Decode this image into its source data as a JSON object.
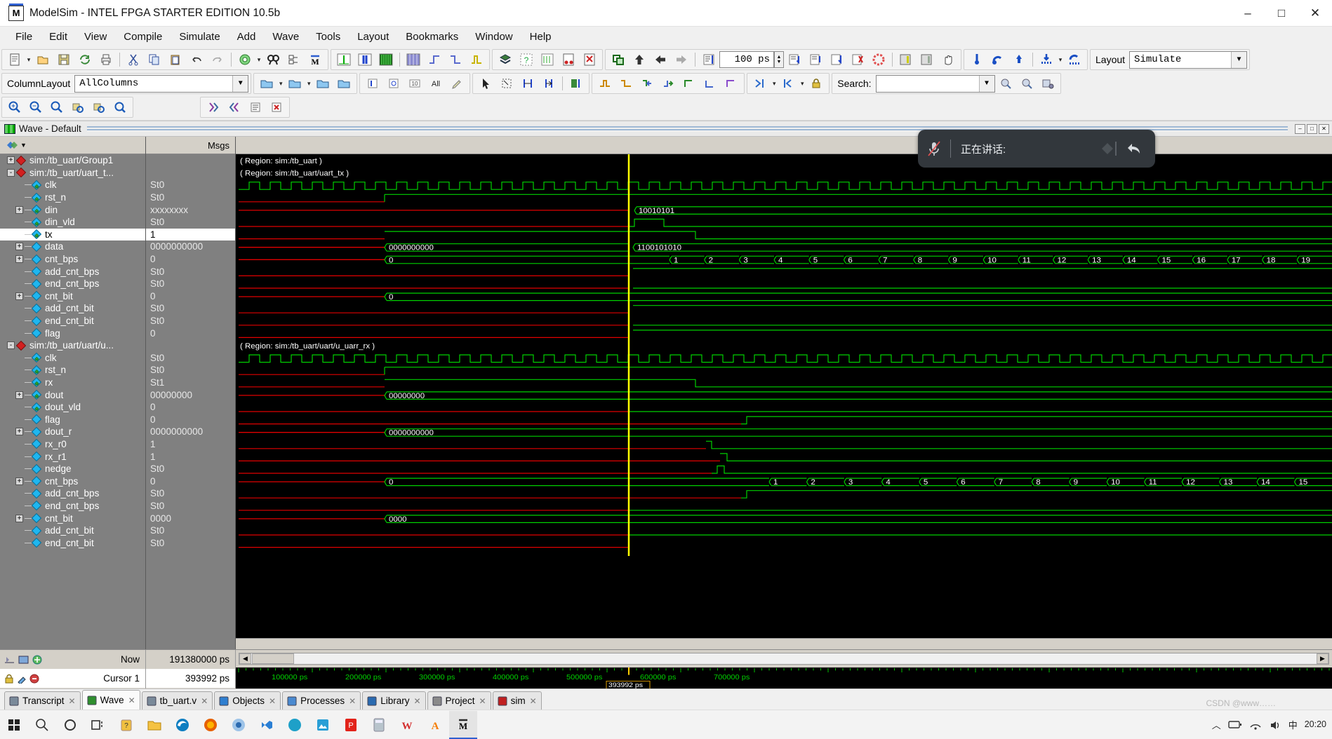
{
  "window": {
    "title": "ModelSim - INTEL FPGA STARTER EDITION 10.5b",
    "app_icon": "modelsim-icon",
    "minimize": "–",
    "maximize": "□",
    "close": "✕"
  },
  "menu": [
    "File",
    "Edit",
    "View",
    "Compile",
    "Simulate",
    "Add",
    "Wave",
    "Tools",
    "Layout",
    "Bookmarks",
    "Window",
    "Help"
  ],
  "toolbar": {
    "time_step_value": "100 ps",
    "column_layout_label": "ColumnLayout",
    "column_layout_value": "AllColumns",
    "layout_label": "Layout",
    "layout_value": "Simulate",
    "search_label": "Search:",
    "search_value": "",
    "search_placeholder": ""
  },
  "wave_window": {
    "caption": "Wave - Default",
    "col_names_header": "",
    "col_msgs_header": "Msgs",
    "minimize": "–",
    "maximize": "□",
    "close": "✕"
  },
  "signals": [
    {
      "name": "sim:/tb_uart/Group1",
      "value": "",
      "depth": 0,
      "expander": "+",
      "icon": "region-icon"
    },
    {
      "name": "sim:/tb_uart/uart_t...",
      "value": "",
      "depth": 0,
      "expander": "-",
      "icon": "region-icon"
    },
    {
      "name": "clk",
      "value": "St0",
      "depth": 1,
      "expander": "",
      "icon": "input-signal-icon"
    },
    {
      "name": "rst_n",
      "value": "St0",
      "depth": 1,
      "expander": "",
      "icon": "input-signal-icon"
    },
    {
      "name": "din",
      "value": "xxxxxxxx",
      "depth": 1,
      "expander": "+",
      "icon": "input-signal-icon"
    },
    {
      "name": "din_vld",
      "value": "St0",
      "depth": 1,
      "expander": "",
      "icon": "input-signal-icon"
    },
    {
      "name": "tx",
      "value": "1",
      "depth": 1,
      "expander": "",
      "icon": "output-signal-icon",
      "selected": true
    },
    {
      "name": "data",
      "value": "0000000000",
      "depth": 1,
      "expander": "+",
      "icon": "internal-signal-icon"
    },
    {
      "name": "cnt_bps",
      "value": "0",
      "depth": 1,
      "expander": "+",
      "icon": "internal-signal-icon"
    },
    {
      "name": "add_cnt_bps",
      "value": "St0",
      "depth": 1,
      "expander": "",
      "icon": "internal-signal-icon"
    },
    {
      "name": "end_cnt_bps",
      "value": "St0",
      "depth": 1,
      "expander": "",
      "icon": "internal-signal-icon"
    },
    {
      "name": "cnt_bit",
      "value": "0",
      "depth": 1,
      "expander": "+",
      "icon": "internal-signal-icon"
    },
    {
      "name": "add_cnt_bit",
      "value": "St0",
      "depth": 1,
      "expander": "",
      "icon": "internal-signal-icon"
    },
    {
      "name": "end_cnt_bit",
      "value": "St0",
      "depth": 1,
      "expander": "",
      "icon": "internal-signal-icon"
    },
    {
      "name": "flag",
      "value": "0",
      "depth": 1,
      "expander": "",
      "icon": "internal-signal-icon"
    },
    {
      "name": "sim:/tb_uart/uart/u...",
      "value": "",
      "depth": 0,
      "expander": "-",
      "icon": "region-icon"
    },
    {
      "name": "clk",
      "value": "St0",
      "depth": 1,
      "expander": "",
      "icon": "input-signal-icon"
    },
    {
      "name": "rst_n",
      "value": "St0",
      "depth": 1,
      "expander": "",
      "icon": "input-signal-icon"
    },
    {
      "name": "rx",
      "value": "St1",
      "depth": 1,
      "expander": "",
      "icon": "input-signal-icon"
    },
    {
      "name": "dout",
      "value": "00000000",
      "depth": 1,
      "expander": "+",
      "icon": "output-signal-icon"
    },
    {
      "name": "dout_vld",
      "value": "0",
      "depth": 1,
      "expander": "",
      "icon": "output-signal-icon"
    },
    {
      "name": "flag",
      "value": "0",
      "depth": 1,
      "expander": "",
      "icon": "internal-signal-icon"
    },
    {
      "name": "dout_r",
      "value": "0000000000",
      "depth": 1,
      "expander": "+",
      "icon": "internal-signal-icon"
    },
    {
      "name": "rx_r0",
      "value": "1",
      "depth": 1,
      "expander": "",
      "icon": "internal-signal-icon"
    },
    {
      "name": "rx_r1",
      "value": "1",
      "depth": 1,
      "expander": "",
      "icon": "internal-signal-icon"
    },
    {
      "name": "nedge",
      "value": "St0",
      "depth": 1,
      "expander": "",
      "icon": "internal-signal-icon"
    },
    {
      "name": "cnt_bps",
      "value": "0",
      "depth": 1,
      "expander": "+",
      "icon": "internal-signal-icon"
    },
    {
      "name": "add_cnt_bps",
      "value": "St0",
      "depth": 1,
      "expander": "",
      "icon": "internal-signal-icon"
    },
    {
      "name": "end_cnt_bps",
      "value": "St0",
      "depth": 1,
      "expander": "",
      "icon": "internal-signal-icon"
    },
    {
      "name": "cnt_bit",
      "value": "0000",
      "depth": 1,
      "expander": "+",
      "icon": "internal-signal-icon"
    },
    {
      "name": "add_cnt_bit",
      "value": "St0",
      "depth": 1,
      "expander": "",
      "icon": "internal-signal-icon"
    },
    {
      "name": "end_cnt_bit",
      "value": "St0",
      "depth": 1,
      "expander": "",
      "icon": "internal-signal-icon"
    }
  ],
  "wave_region_labels": [
    {
      "text": "( Region: sim:/tb_uart )",
      "row": 0
    },
    {
      "text": "( Region: sim:/tb_uart/uart_tx )",
      "row": 1
    },
    {
      "text": "( Region: sim:/tb_uart/uart/u_uarr_rx )",
      "row": 15
    }
  ],
  "wave_bus_labels": [
    {
      "text": "10010101",
      "row": 4
    },
    {
      "text": "0000000000",
      "row": 7
    },
    {
      "text": "1100101010",
      "row": 7
    },
    {
      "text": "0",
      "row": 8
    },
    {
      "text": "0",
      "row": 11
    },
    {
      "text": "00000000",
      "row": 19
    },
    {
      "text": "0000000000",
      "row": 22
    },
    {
      "text": "0",
      "row": 26
    },
    {
      "text": "0000",
      "row": 29
    }
  ],
  "bus_counter_tx": [
    "1",
    "2",
    "3",
    "4",
    "5",
    "6",
    "7",
    "8",
    "9",
    "10",
    "11",
    "12",
    "13",
    "14",
    "15",
    "16",
    "17",
    "18",
    "19"
  ],
  "bus_counter_rx": [
    "1",
    "2",
    "3",
    "4",
    "5",
    "6",
    "7",
    "8",
    "9",
    "10",
    "11",
    "12",
    "13",
    "14",
    "15"
  ],
  "timeline": {
    "ticks": [
      "100000 ps",
      "200000 ps",
      "300000 ps",
      "400000 ps",
      "500000 ps",
      "600000 ps",
      "700000 ps"
    ],
    "cursor_label": "393992 ps"
  },
  "status": {
    "now_label": "Now",
    "now_value": "191380000 ps",
    "cursor_label": "Cursor 1",
    "cursor_value": "393992 ps"
  },
  "bottom_tabs": [
    {
      "label": "Transcript",
      "icon": "transcript-icon",
      "active": false
    },
    {
      "label": "Wave",
      "icon": "wave-icon",
      "active": true
    },
    {
      "label": "tb_uart.v",
      "icon": "file-icon",
      "active": false
    },
    {
      "label": "Objects",
      "icon": "objects-icon",
      "active": false
    },
    {
      "label": "Processes",
      "icon": "processes-icon",
      "active": false
    },
    {
      "label": "Library",
      "icon": "library-icon",
      "active": false
    },
    {
      "label": "Project",
      "icon": "project-icon",
      "active": false
    },
    {
      "label": "sim",
      "icon": "sim-icon",
      "active": false
    }
  ],
  "speaking_widget": {
    "text": "正在讲话:",
    "mic_icon": "mic-muted-icon",
    "share_icon": "share-icon",
    "reply_icon": "reply-icon"
  },
  "taskbar": {
    "apps": [
      "start-icon",
      "search-icon",
      "cortana-icon",
      "taskview-icon",
      "store-icon",
      "explorer-icon",
      "edge-icon",
      "firefox-icon",
      "chrome-icon",
      "vscode-icon",
      "photoshop-icon",
      "mountain-icon",
      "pdf-icon",
      "calculator-icon",
      "w-icon",
      "a-icon",
      "modelsim-icon"
    ],
    "tray": [
      "chevron-up-icon",
      "battery-icon",
      "network-icon",
      "volume-icon",
      "ime-icon"
    ],
    "ime": "中",
    "time": "20:20"
  },
  "watermark": "CSDN @www……",
  "colors": {
    "wave_green": "#00d000",
    "wave_red": "#e00000",
    "cursor_yellow": "#ffff00",
    "pane_bg": "#808080",
    "wave_bg": "#000000"
  }
}
